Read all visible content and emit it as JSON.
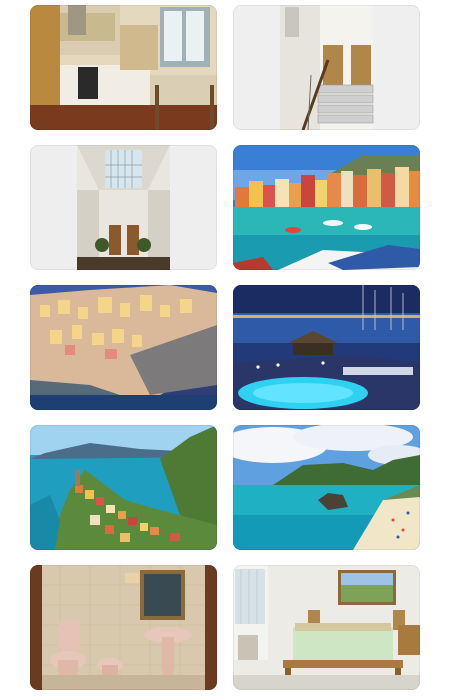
{
  "gallery": {
    "photos": [
      {
        "subject": "kitchen"
      },
      {
        "subject": "stairwell"
      },
      {
        "subject": "skylight-courtyard"
      },
      {
        "subject": "harbor-village"
      },
      {
        "subject": "cliff-village-night"
      },
      {
        "subject": "pool-marina-night"
      },
      {
        "subject": "coastal-village-aerial"
      },
      {
        "subject": "beach-cove"
      },
      {
        "subject": "bathroom"
      },
      {
        "subject": "bedroom"
      }
    ]
  },
  "colors": {
    "tile_background": "#eeeeee",
    "sea": "#1f9ec0",
    "sky": "#3a7fd6",
    "night_sky": "#233a7a"
  }
}
